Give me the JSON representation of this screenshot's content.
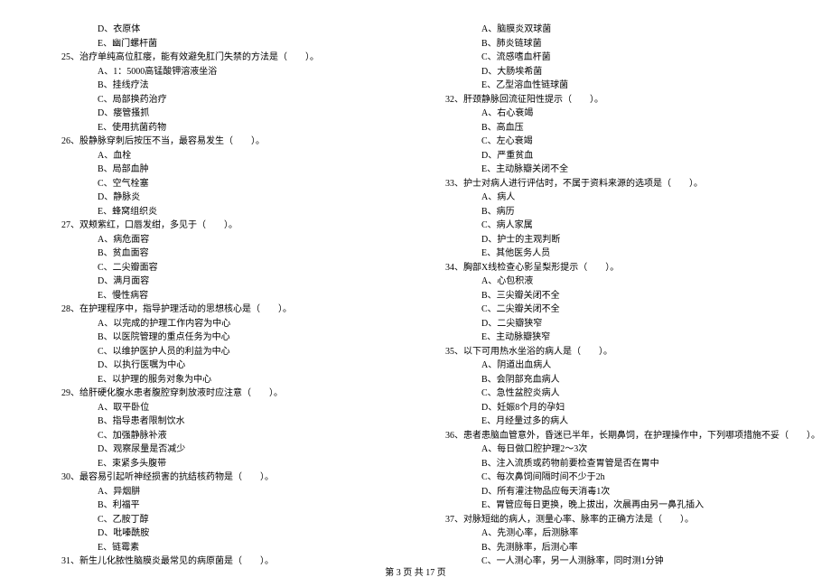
{
  "left": {
    "q24": {
      "D": "D、衣原体",
      "E": "E、幽门螺杆菌"
    },
    "q25": {
      "stem": "25、治疗单纯高位肛瘘，能有效避免肛门失禁的方法是（　　）。",
      "A": "A、1：5000高锰酸钾溶液坐浴",
      "B": "B、挂线疗法",
      "C": "C、局部换药治疗",
      "D": "D、瘘管搔抓",
      "E": "E、使用抗菌药物"
    },
    "q26": {
      "stem": "26、股静脉穿刺后按压不当，最容易发生（　　）。",
      "A": "A、血栓",
      "B": "B、局部血肿",
      "C": "C、空气栓塞",
      "D": "D、静脉炎",
      "E": "E、蜂窝组织炎"
    },
    "q27": {
      "stem": "27、双颊紫红，口唇发绀，多见于（　　）。",
      "A": "A、病危面容",
      "B": "B、贫血面容",
      "C": "C、二尖瓣面容",
      "D": "D、满月面容",
      "E": "E、慢性病容"
    },
    "q28": {
      "stem": "28、在护理程序中，指导护理活动的思想核心是（　　）。",
      "A": "A、以完成的护理工作内容为中心",
      "B": "B、以医院管理的重点任务为中心",
      "C": "C、以维护医护人员的利益为中心",
      "D": "D、以执行医嘱为中心",
      "E": "E、以护理的服务对象为中心"
    },
    "q29": {
      "stem": "29、给肝硬化腹水患者腹腔穿刺放液时应注意（　　）。",
      "A": "A、取平卧位",
      "B": "B、指导患者限制饮水",
      "C": "C、加强静脉补液",
      "D": "D、观察尿量是否减少",
      "E": "E、束紧多头腹带"
    },
    "q30": {
      "stem": "30、最容易引起听神经损害的抗结核药物是（　　）。",
      "A": "A、异烟肼",
      "B": "B、利福平",
      "C": "C、乙胺丁醇",
      "D": "D、吡嗪酰胺",
      "E": "E、链霉素"
    },
    "q31": {
      "stem": "31、新生儿化脓性脑膜炎最常见的病原菌是（　　）。"
    }
  },
  "right": {
    "q31": {
      "A": "A、脑膜炎双球菌",
      "B": "B、肺炎链球菌",
      "C": "C、流感嗜血杆菌",
      "D": "D、大肠埃希菌",
      "E": "E、乙型溶血性链球菌"
    },
    "q32": {
      "stem": "32、肝颈静脉回流征阳性提示（　　）。",
      "A": "A、右心衰竭",
      "B": "B、高血压",
      "C": "C、左心衰竭",
      "D": "D、严重贫血",
      "E": "E、主动脉瓣关闭不全"
    },
    "q33": {
      "stem": "33、护士对病人进行评估时，不属于资料来源的选项是（　　）。",
      "A": "A、病人",
      "B": "B、病历",
      "C": "C、病人家属",
      "D": "D、护士的主观判断",
      "E": "E、其他医务人员"
    },
    "q34": {
      "stem": "34、胸部X线检查心影呈梨形提示（　　）。",
      "A": "A、心包积液",
      "B": "B、三尖瓣关闭不全",
      "C": "C、二尖瓣关闭不全",
      "D": "D、二尖瓣狭窄",
      "E": "E、主动脉瓣狭窄"
    },
    "q35": {
      "stem": "35、以下可用热水坐浴的病人是（　　）。",
      "A": "A、阴道出血病人",
      "B": "B、会阴部充血病人",
      "C": "C、急性盆腔炎病人",
      "D": "D、妊娠8个月的孕妇",
      "E": "E、月经量过多的病人"
    },
    "q36": {
      "stem": "36、患者患脑血管意外，昏迷已半年，长期鼻饲，在护理操作中，下列哪项措施不妥（　　）。",
      "A": "A、每日做口腔护理2～3次",
      "B": "B、注入流质或药物前要检查胃管是否在胃中",
      "C": "C、每次鼻饲间隔时间不少于2h",
      "D": "D、所有灌注物品应每天消毒1次",
      "E": "E、胃管应每日更换，晚上拔出，次晨再由另一鼻孔插入"
    },
    "q37": {
      "stem": "37、对脉短绌的病人，测量心率、脉率的正确方法是（　　）。",
      "A": "A、先测心率，后测脉率",
      "B": "B、先测脉率，后测心率",
      "C": "C、一人测心率，另一人测脉率，同时测1分钟"
    }
  },
  "footer": {
    "prefix": "第 ",
    "page": "3",
    "mid": " 页 共 ",
    "total": "17",
    "suffix": " 页"
  }
}
